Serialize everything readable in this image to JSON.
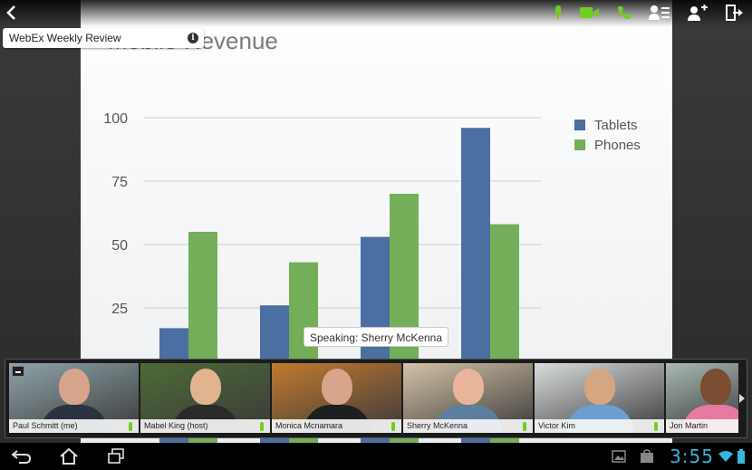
{
  "meeting": {
    "title": "WebEx Weekly Review",
    "speaking_label": "Speaking: Sherry McKenna"
  },
  "slide": {
    "title": "Mobile Revenue"
  },
  "chart_data": {
    "type": "bar",
    "categories": [
      "",
      "",
      "",
      ""
    ],
    "series": [
      {
        "name": "Tablets",
        "values": [
          17,
          26,
          53,
          96
        ],
        "color": "#4a6fa0"
      },
      {
        "name": "Phones",
        "values": [
          55,
          43,
          70,
          58
        ],
        "color": "#74ae59"
      }
    ],
    "yticks": [
      25,
      50,
      75,
      100
    ],
    "ylim": [
      0,
      100
    ],
    "legend_position": "top-right",
    "grid": true
  },
  "toolbar": {
    "icons": [
      "back-icon",
      "microphone-icon",
      "video-camera-icon",
      "phone-icon",
      "participants-list-icon",
      "add-participant-icon",
      "leave-meeting-icon"
    ],
    "colors": {
      "green": "#6fcf1d",
      "white": "#ffffff"
    }
  },
  "participants": [
    {
      "name": "Paul Schmitt (me)",
      "skin": "#d7a58c",
      "shirt": "#2b3240",
      "bg": "#8fa3a8",
      "mic": "active"
    },
    {
      "name": "Mabel King (host)",
      "skin": "#e2b38f",
      "shirt": "#2a2a2a",
      "bg": "#4d6b36",
      "mic": "active"
    },
    {
      "name": "Monica Mcnamara",
      "skin": "#d9a58a",
      "shirt": "#1f1f1f",
      "bg": "#c27a2f",
      "mic": "active"
    },
    {
      "name": "Sherry McKenna",
      "skin": "#e8b59a",
      "shirt": "#5e7ea0",
      "bg": "#d4c2a6",
      "mic": "speaking"
    },
    {
      "name": "Victor Kim",
      "skin": "#d4a782",
      "shirt": "#6c9fcf",
      "bg": "#d9dcdd",
      "mic": "active"
    },
    {
      "name": "Jon Martin",
      "skin": "#7a4d33",
      "shirt": "#e67aa0",
      "bg": "#a9b9b4",
      "mic": "none"
    }
  ],
  "status_bar": {
    "time": "3:55"
  },
  "nav_icons": [
    "back-nav-icon",
    "home-nav-icon",
    "recent-apps-icon"
  ],
  "status_icons": [
    "gallery-icon",
    "store-icon",
    "wifi-icon",
    "battery-icon"
  ]
}
